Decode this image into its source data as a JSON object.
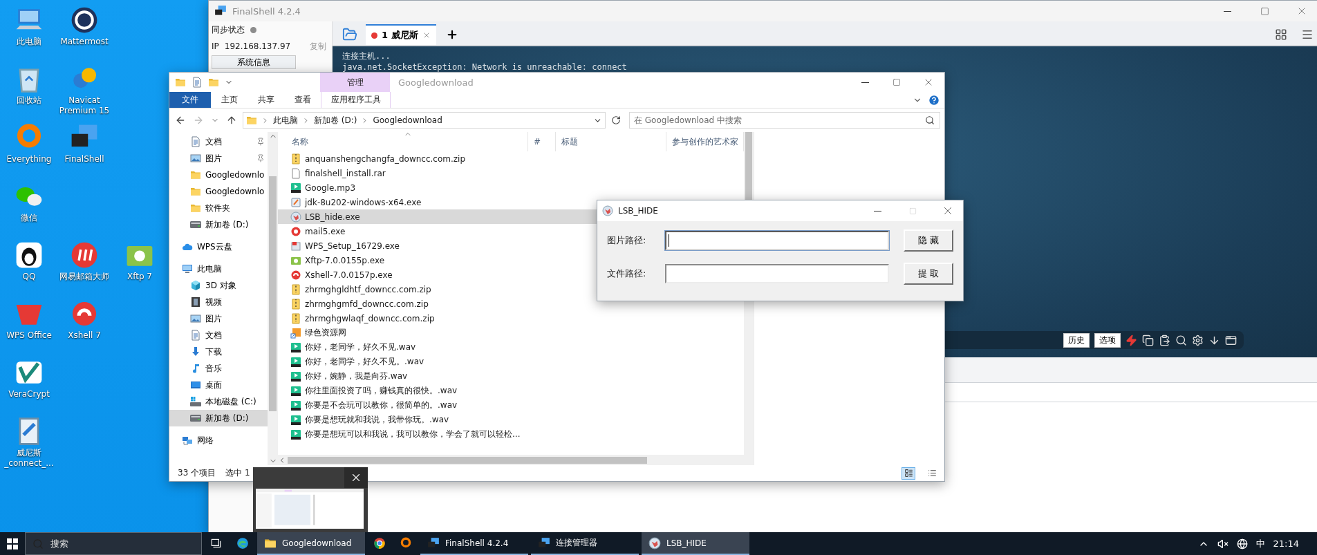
{
  "desktop": {
    "icon_rows": [
      [
        {
          "label": "此电脑",
          "kind": "computer"
        },
        {
          "label": "Mattermost",
          "kind": "mattermost"
        }
      ],
      [
        {
          "label": "回收站",
          "kind": "recycle"
        },
        {
          "label": "Navicat Premium 15",
          "kind": "navicat"
        }
      ],
      [
        {
          "label": "Everything",
          "kind": "everything"
        },
        {
          "label": "FinalShell",
          "kind": "finalshell"
        }
      ],
      [
        {
          "label": "微信",
          "kind": "wechat"
        }
      ],
      [
        {
          "label": "QQ",
          "kind": "qq"
        },
        {
          "label": "网易邮箱大师",
          "kind": "mailapp"
        },
        {
          "label": "Xftp 7",
          "kind": "xftp"
        }
      ],
      [
        {
          "label": "WPS Office",
          "kind": "wps"
        },
        {
          "label": "Xshell 7",
          "kind": "xshell"
        }
      ],
      [
        {
          "label": "VeraCrypt",
          "kind": "veracrypt"
        }
      ],
      [
        {
          "label": "威尼斯_connect_...",
          "kind": "connect"
        }
      ]
    ]
  },
  "finalshell": {
    "title": "FinalShell 4.2.4",
    "sync_label": "同步状态",
    "synced": false,
    "ip_label": "IP",
    "ip": "192.168.137.97",
    "copy_link": "复制",
    "sysinfo_button": "系统信息",
    "tabs": [
      {
        "label": "1 威尼斯",
        "selected": true,
        "connected": false
      }
    ],
    "terminal_lines": [
      "连接主机...",
      "java.net.SocketException: Network is unreachable: connect"
    ],
    "toolbar_buttons": [
      "历史",
      "选项"
    ]
  },
  "explorer": {
    "title": "Googledownload",
    "context_tab": "管理",
    "ribbon_tabs": [
      {
        "label": "文件",
        "kind": "file"
      },
      {
        "label": "主页",
        "kind": "normal"
      },
      {
        "label": "共享",
        "kind": "normal"
      },
      {
        "label": "查看",
        "kind": "normal"
      },
      {
        "label": "应用程序工具",
        "kind": "context"
      }
    ],
    "breadcrumb": [
      "此电脑",
      "新加卷 (D:)",
      "Googledownload"
    ],
    "search_placeholder": "在 Googledownload 中搜索",
    "quick_access": [
      {
        "label": "文档",
        "kind": "doc",
        "pinned": true,
        "selected": false
      },
      {
        "label": "图片",
        "kind": "picture",
        "pinned": true,
        "selected": false
      },
      {
        "label": "Googledownlo",
        "kind": "folder",
        "pinned": false,
        "selected": false
      },
      {
        "label": "Googledownlo",
        "kind": "folder",
        "pinned": false,
        "selected": false
      },
      {
        "label": "软件夹",
        "kind": "folder",
        "pinned": false,
        "selected": false
      },
      {
        "label": "新加卷 (D:)",
        "kind": "drive",
        "pinned": false,
        "selected": false
      }
    ],
    "nav_tree": [
      {
        "label": "WPS云盘",
        "kind": "cloud",
        "selected": false
      },
      {
        "label": "此电脑",
        "kind": "pc",
        "selected": false,
        "children": [
          {
            "label": "3D 对象",
            "kind": "cube",
            "selected": false
          },
          {
            "label": "视频",
            "kind": "video",
            "selected": false
          },
          {
            "label": "图片",
            "kind": "picture",
            "selected": false
          },
          {
            "label": "文档",
            "kind": "doc",
            "selected": false
          },
          {
            "label": "下载",
            "kind": "download",
            "selected": false
          },
          {
            "label": "音乐",
            "kind": "music",
            "selected": false
          },
          {
            "label": "桌面",
            "kind": "desktop",
            "selected": false
          },
          {
            "label": "本地磁盘 (C:)",
            "kind": "disk",
            "selected": false
          },
          {
            "label": "新加卷 (D:)",
            "kind": "drive",
            "selected": true
          }
        ]
      },
      {
        "label": "网络",
        "kind": "network",
        "selected": false
      }
    ],
    "columns": [
      "名称",
      "#",
      "标题",
      "参与创作的艺术家"
    ],
    "files": [
      {
        "name": "anquanshengchangfa_downcc.com.zip",
        "kind": "zip",
        "selected": false
      },
      {
        "name": "finalshell_install.rar",
        "kind": "file",
        "selected": false
      },
      {
        "name": "Google.mp3",
        "kind": "audio",
        "selected": false
      },
      {
        "name": "jdk-8u202-windows-x64.exe",
        "kind": "installer",
        "selected": false
      },
      {
        "name": "LSB_hide.exe",
        "kind": "lsb",
        "selected": true
      },
      {
        "name": "mail5.exe",
        "kind": "mail",
        "selected": false
      },
      {
        "name": "WPS_Setup_16729.exe",
        "kind": "wpsinst",
        "selected": false
      },
      {
        "name": "Xftp-7.0.0155p.exe",
        "kind": "xftp",
        "selected": false
      },
      {
        "name": "Xshell-7.0.0157p.exe",
        "kind": "xshell",
        "selected": false
      },
      {
        "name": "zhrmghgldhtf_downcc.com.zip",
        "kind": "zip",
        "selected": false
      },
      {
        "name": "zhrmghgmfd_downcc.com.zip",
        "kind": "zip",
        "selected": false
      },
      {
        "name": "zhrmghgwlaqf_downcc.com.zip",
        "kind": "zip",
        "selected": false
      },
      {
        "name": "绿色资源网",
        "kind": "shortcut",
        "selected": false
      },
      {
        "name": "你好，老同学，好久不见.wav",
        "kind": "audio",
        "selected": false
      },
      {
        "name": "你好，老同学，好久不见。.wav",
        "kind": "audio",
        "selected": false
      },
      {
        "name": "你好，婉静，我是向芬.wav",
        "kind": "audio",
        "selected": false
      },
      {
        "name": "你往里面投资了吗，赚钱真的很快。.wav",
        "kind": "audio",
        "selected": false
      },
      {
        "name": "你要是不会玩可以教你，很简单的。.wav",
        "kind": "audio",
        "selected": false
      },
      {
        "name": "你要是想玩就和我说，我带你玩。.wav",
        "kind": "audio",
        "selected": false
      },
      {
        "name": "你要是想玩可以和我说，我可以教你，学会了就可以轻松...",
        "kind": "audio",
        "selected": false
      }
    ],
    "status_count": "33 个项目",
    "status_selection": "选中 1",
    "views": [
      {
        "kind": "details",
        "selected": true
      },
      {
        "kind": "tiles",
        "selected": false
      }
    ]
  },
  "lsb_hide": {
    "title": "LSB_HIDE",
    "rows": [
      {
        "label": "图片路径:",
        "button": "隐 藏",
        "focused": true
      },
      {
        "label": "文件路径:",
        "button": "提 取",
        "focused": false
      }
    ]
  },
  "taskbar": {
    "search_placeholder": "搜索",
    "items": [
      {
        "kind": "taskview",
        "highlighted": false
      },
      {
        "kind": "edge",
        "highlighted": false
      },
      {
        "kind": "folder",
        "label": "Googledownload",
        "highlighted": true
      },
      {
        "kind": "chrome",
        "highlighted": false
      },
      {
        "kind": "everything",
        "highlighted": false
      },
      {
        "kind": "finalshell",
        "label": "FinalShell 4.2.4",
        "highlighted": false
      },
      {
        "kind": "finalshell",
        "label": "连接管理器",
        "highlighted": false
      },
      {
        "kind": "lsb",
        "label": "LSB_HIDE",
        "highlighted": true
      }
    ],
    "ime": "中",
    "time": "21:14"
  }
}
